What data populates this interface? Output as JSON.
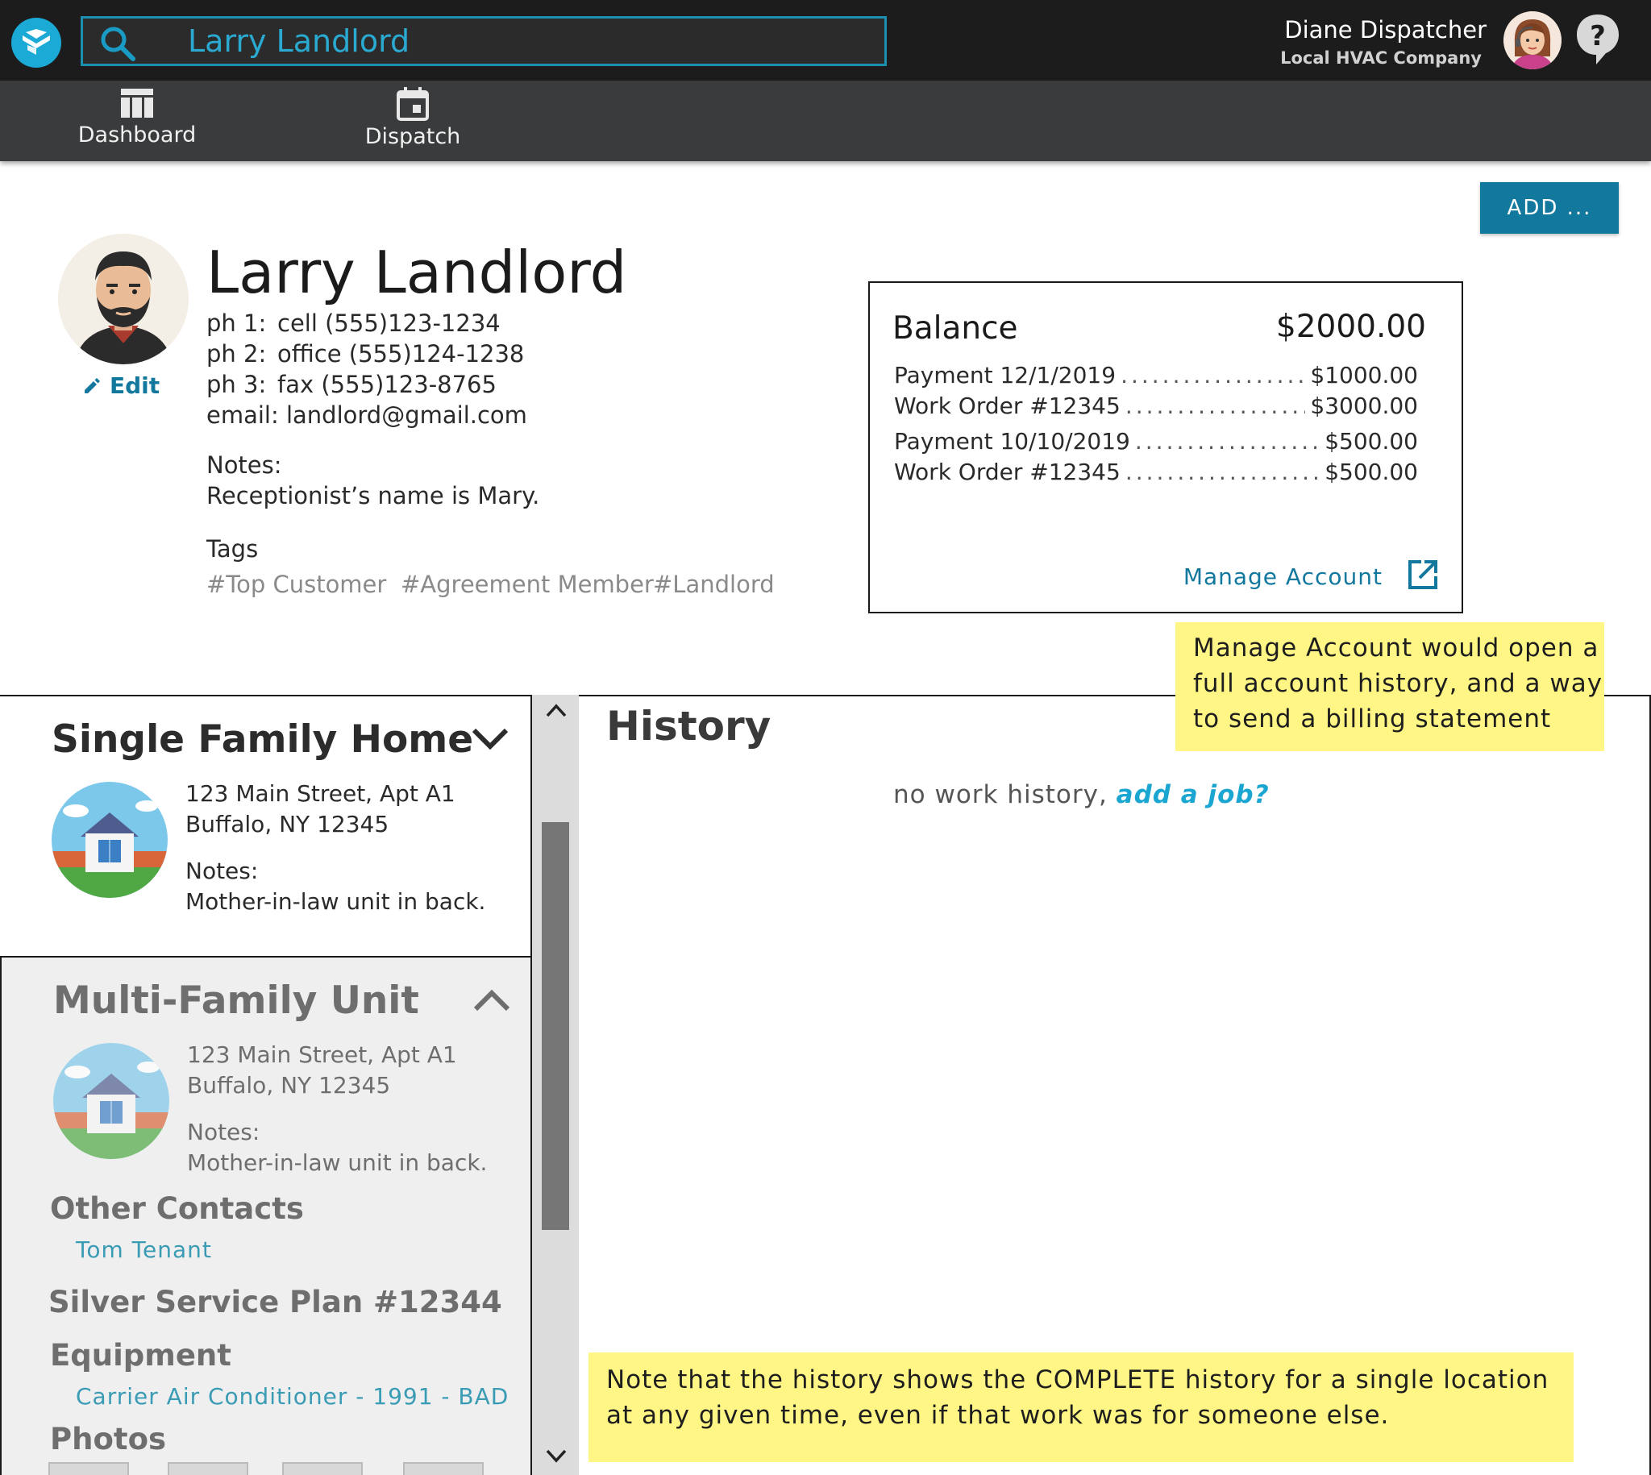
{
  "header": {
    "search_value": "Larry Landlord",
    "user_name": "Diane Dispatcher",
    "company": "Local HVAC Company"
  },
  "nav": [
    {
      "label": "Dashboard",
      "icon": "dashboard-icon"
    },
    {
      "label": "Dispatch",
      "icon": "calendar-icon"
    }
  ],
  "add_button": "ADD ...",
  "customer": {
    "name": "Larry Landlord",
    "edit_label": "Edit",
    "phones": [
      {
        "label": "ph 1:",
        "value": "cell (555)123-1234"
      },
      {
        "label": "ph 2:",
        "value": "office (555)124-1238"
      },
      {
        "label": "ph 3:",
        "value": "fax (555)123-8765"
      }
    ],
    "email_label": "email:",
    "email": "landlord@gmail.com",
    "notes_label": "Notes:",
    "notes": "Receptionist’s name is Mary.",
    "tags_label": "Tags",
    "tags": [
      "#Top Customer",
      "#Agreement Member",
      "#Landlord"
    ]
  },
  "balance": {
    "title": "Balance",
    "total": "$2000.00",
    "entries": [
      {
        "label": "Payment 12/1/2019",
        "amount": "$1000.00"
      },
      {
        "label": "Work Order #12345",
        "amount": "$3000.00"
      },
      {
        "label": "Payment 10/10/2019",
        "amount": "$500.00"
      },
      {
        "label": "Work Order #12345",
        "amount": "$500.00"
      }
    ],
    "manage_label": "Manage Account"
  },
  "sticky_notes": {
    "manage": "Manage Account would open a full account history, and a way to send a billing statement",
    "history": "Note that the history shows the COMPLETE history for a single location at any given time, even if that work was for someone else."
  },
  "locations": [
    {
      "title": "Single Family Home",
      "address1": "123 Main Street, Apt A1",
      "address2": "Buffalo, NY 12345",
      "notes_label": "Notes:",
      "notes": "Mother-in-law unit in back."
    },
    {
      "title": "Multi-Family Unit",
      "address1": "123 Main Street, Apt A1",
      "address2": "Buffalo, NY 12345",
      "notes_label": "Notes:",
      "notes": "Mother-in-law unit in back.",
      "other_contacts_label": "Other Contacts",
      "other_contact": "Tom Tenant",
      "service_plan": "Silver Service Plan #12344",
      "equipment_label": "Equipment",
      "equipment_item": "Carrier Air Conditioner - 1991 - BAD",
      "photos_label": "Photos"
    }
  ],
  "history": {
    "title": "History",
    "empty_text": "no work history, ",
    "add_job_label": "add a job?"
  },
  "colors": {
    "accent": "#13789e",
    "link": "#1aa6d1",
    "sticky": "#fff685",
    "topbar": "#1c1c1c",
    "navbar": "#393b3c"
  }
}
